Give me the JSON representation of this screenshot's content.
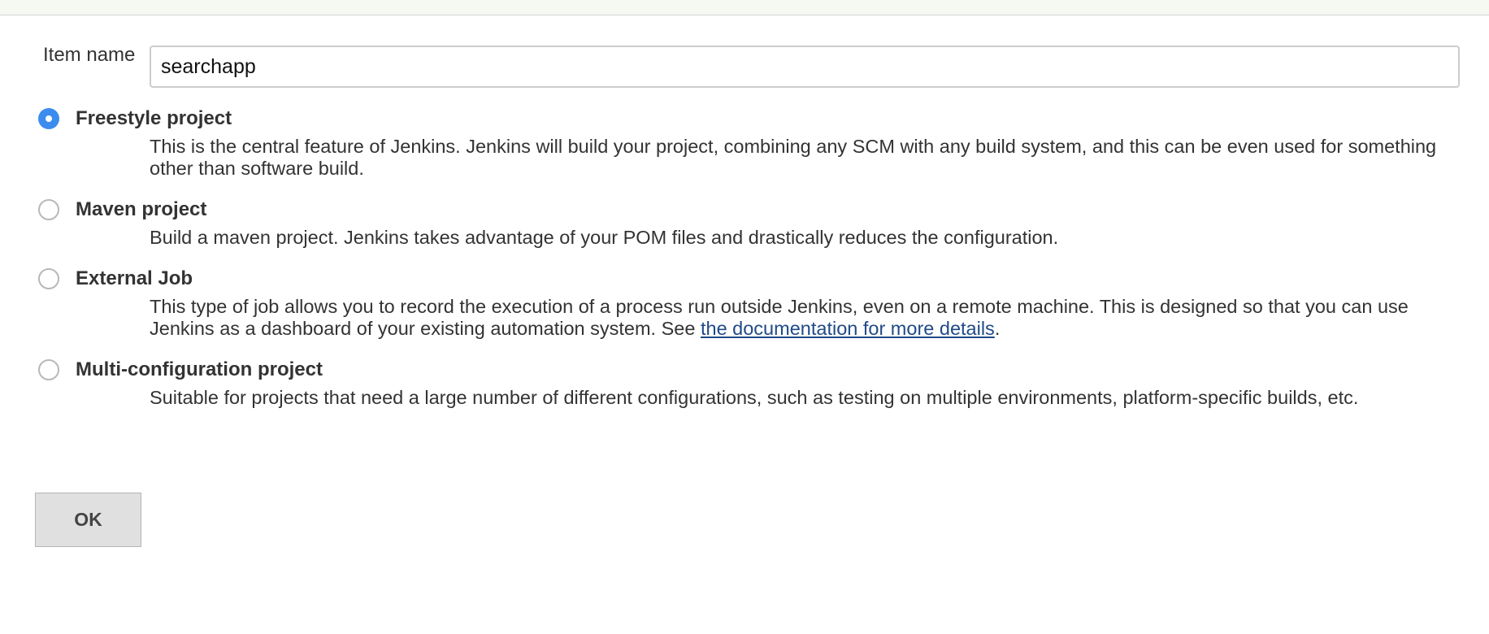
{
  "form": {
    "item_name_label": "Item name",
    "item_name_value": "searchapp"
  },
  "options": [
    {
      "title": "Freestyle project",
      "selected": true,
      "description": "This is the central feature of Jenkins. Jenkins will build your project, combining any SCM with any build system, and this can be even used for something other than software build."
    },
    {
      "title": "Maven project",
      "selected": false,
      "description": "Build a maven project. Jenkins takes advantage of your POM files and drastically reduces the configuration."
    },
    {
      "title": "External Job",
      "selected": false,
      "description_prefix": "This type of job allows you to record the execution of a process run outside Jenkins, even on a remote machine. This is designed so that you can use Jenkins as a dashboard of your existing automation system. See ",
      "link_text": "the documentation for more details",
      "description_suffix": "."
    },
    {
      "title": "Multi-configuration project",
      "selected": false,
      "description": "Suitable for projects that need a large number of different configurations, such as testing on multiple environments, platform-specific builds, etc."
    }
  ],
  "ok_button_label": "OK",
  "colors": {
    "radio_selected": "#3b8cee",
    "link": "#204a87",
    "top_band": "#f6f8f2",
    "button_bg": "#e0e0e0"
  }
}
